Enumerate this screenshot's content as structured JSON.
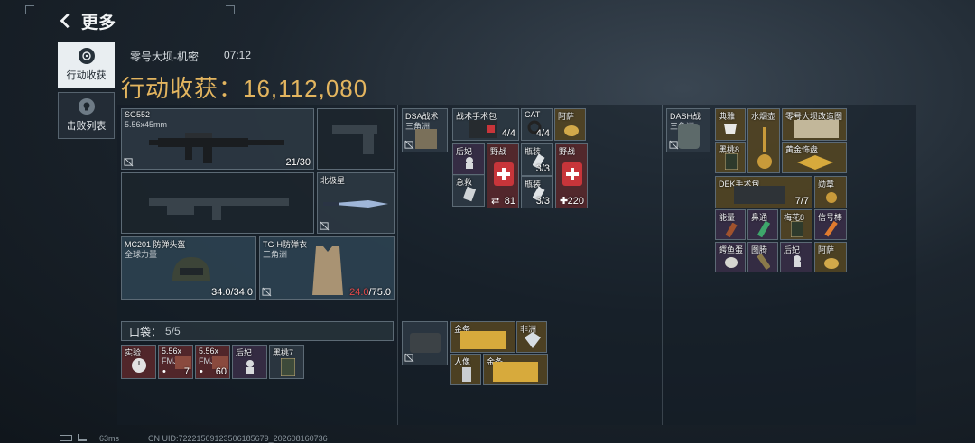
{
  "topbar": {
    "back_label": "更多"
  },
  "tabs": [
    {
      "label": "行动收获",
      "icon": "crosshair-icon",
      "active": true
    },
    {
      "label": "击败列表",
      "icon": "skull-icon",
      "active": false
    }
  ],
  "header": {
    "map": "零号大坝-机密",
    "time": "07:12",
    "haul_label": "行动收获：",
    "haul_value": "16,112,080"
  },
  "loadout": {
    "primary": {
      "name": "SG552",
      "ammo_type": "5.56x45mm",
      "ammo": "21/30"
    },
    "holster": {
      "name": "北极星"
    },
    "helmet": {
      "name": "MC201 防弹头盔",
      "maker": "全球力量",
      "durability": "34.0/34.0"
    },
    "armor": {
      "name": "TG-H防弹衣",
      "maker": "三角洲",
      "durability_current": "24.0",
      "durability_max": "/75.0"
    },
    "pocket_label": "口袋：",
    "pocket_value": "5/5",
    "pocket_items": [
      {
        "name": "实验",
        "count": ""
      },
      {
        "name": "5.56x",
        "sub": "FMJ",
        "count": "7"
      },
      {
        "name": "5.56x",
        "sub": "FMJ",
        "count": "60"
      },
      {
        "name": "后妃",
        "count": ""
      },
      {
        "name": "黑桃7",
        "count": ""
      }
    ]
  },
  "chest_rig": {
    "name": "DSA战术",
    "sub": "三角洲",
    "items": [
      {
        "name": "战术手术包",
        "count": "4/4"
      },
      {
        "name": "CAT",
        "count": "4/4"
      },
      {
        "name": "阿萨",
        "count": ""
      },
      {
        "name": "后妃",
        "count": ""
      },
      {
        "name": "急救",
        "count": ""
      },
      {
        "name": "野战",
        "count": "81"
      },
      {
        "name": "瓶装",
        "count": "3/3"
      },
      {
        "name": "瓶装",
        "count": "3/3"
      },
      {
        "name": "野战",
        "count": "220"
      }
    ]
  },
  "case": {
    "items": [
      {
        "name": "金条"
      },
      {
        "name": "非洲"
      },
      {
        "name": "人像"
      },
      {
        "name": "金条"
      }
    ]
  },
  "backpack": {
    "name": "DASH战",
    "sub": "三角洲",
    "items": [
      {
        "name": "典雅"
      },
      {
        "name": "水烟壶"
      },
      {
        "name": "零号大坝改造图"
      },
      {
        "name": "黑桃8"
      },
      {
        "name": "黄金饰盘"
      },
      {
        "name": "DEK手术包",
        "count": "7/7"
      },
      {
        "name": "勋章"
      },
      {
        "name": "能量"
      },
      {
        "name": "鼻通"
      },
      {
        "name": "梅花8"
      },
      {
        "name": "信号棒"
      },
      {
        "name": "鳄鱼蛋"
      },
      {
        "name": "图腾"
      },
      {
        "name": "后妃"
      },
      {
        "name": "阿萨"
      }
    ]
  },
  "footer": {
    "ping": "63ms",
    "uid": "CN UID:72221509123506185679_202608160736"
  },
  "colors": {
    "accent_gold": "#e3b55f",
    "damaged_red": "#e34a4a"
  }
}
